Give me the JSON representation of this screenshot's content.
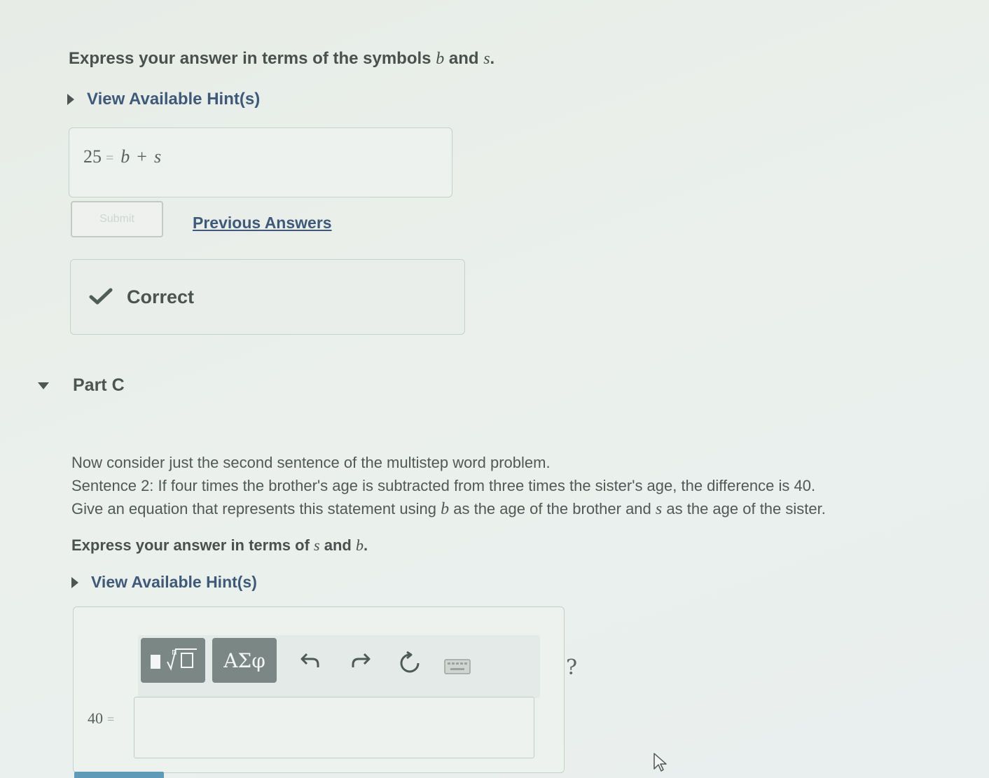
{
  "part_b": {
    "instruction_prefix": "Express your answer in terms of the symbols",
    "instruction_sym1": "b",
    "instruction_and": "and",
    "instruction_sym2": "s",
    "instruction_end": ".",
    "hint_label": "View Available Hint(s)",
    "answer_lhs": "25",
    "answer_eq": "=",
    "answer_b": "b",
    "answer_plus": "+",
    "answer_s": "s",
    "submit_label": "Submit",
    "previous_answers_label": "Previous Answers",
    "feedback_text": "Correct"
  },
  "part_c": {
    "title": "Part C",
    "line1": "Now consider just the second sentence of the multistep word problem.",
    "line2": "Sentence 2: If four times the brother's age is subtracted from three times the sister's age, the difference is 40.",
    "line3_prefix": "Give an equation that represents this statement using",
    "line3_sym1": "b",
    "line3_middle": "as the age of the brother and",
    "line3_sym2": "s",
    "line3_suffix": "as the age of the sister.",
    "instruction_prefix": "Express your answer in terms of",
    "instruction_sym1": "s",
    "instruction_and": "and",
    "instruction_sym2": "b",
    "instruction_end": ".",
    "hint_label": "View Available Hint(s)",
    "toolbar": {
      "greek_label": "ΑΣφ",
      "help_label": "?"
    },
    "answer_lhs": "40",
    "answer_eq": "=",
    "answer_value": ""
  },
  "colors": {
    "link": "#3f5a78",
    "correct_check": "#4f5d57",
    "toolbar_button": "#7a8784"
  }
}
